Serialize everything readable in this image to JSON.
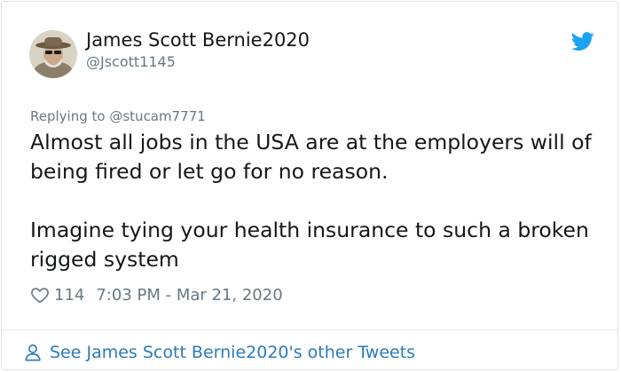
{
  "tweet": {
    "author": {
      "display_name": "James Scott Bernie2020",
      "handle": "@Jscott1145"
    },
    "reply_to": {
      "prefix": "Replying to",
      "mention": "@stucam7771"
    },
    "text_paragraphs": [
      "Almost all jobs in the USA are at the employers will of being fired or let go for no reason.",
      "Imagine tying your health insurance to such a broken rigged system"
    ],
    "likes": "114",
    "timestamp": "7:03 PM - Mar 21, 2020",
    "footer_link": "See James Scott Bernie2020's other Tweets"
  },
  "icons": {
    "logo": "twitter-bird-icon",
    "like": "heart-icon",
    "profile": "person-icon"
  },
  "colors": {
    "twitter_blue": "#1da1f2",
    "link_blue": "#2b7bb9",
    "text_primary": "#14171a",
    "text_secondary": "#697882",
    "border": "#dfe3e6"
  }
}
